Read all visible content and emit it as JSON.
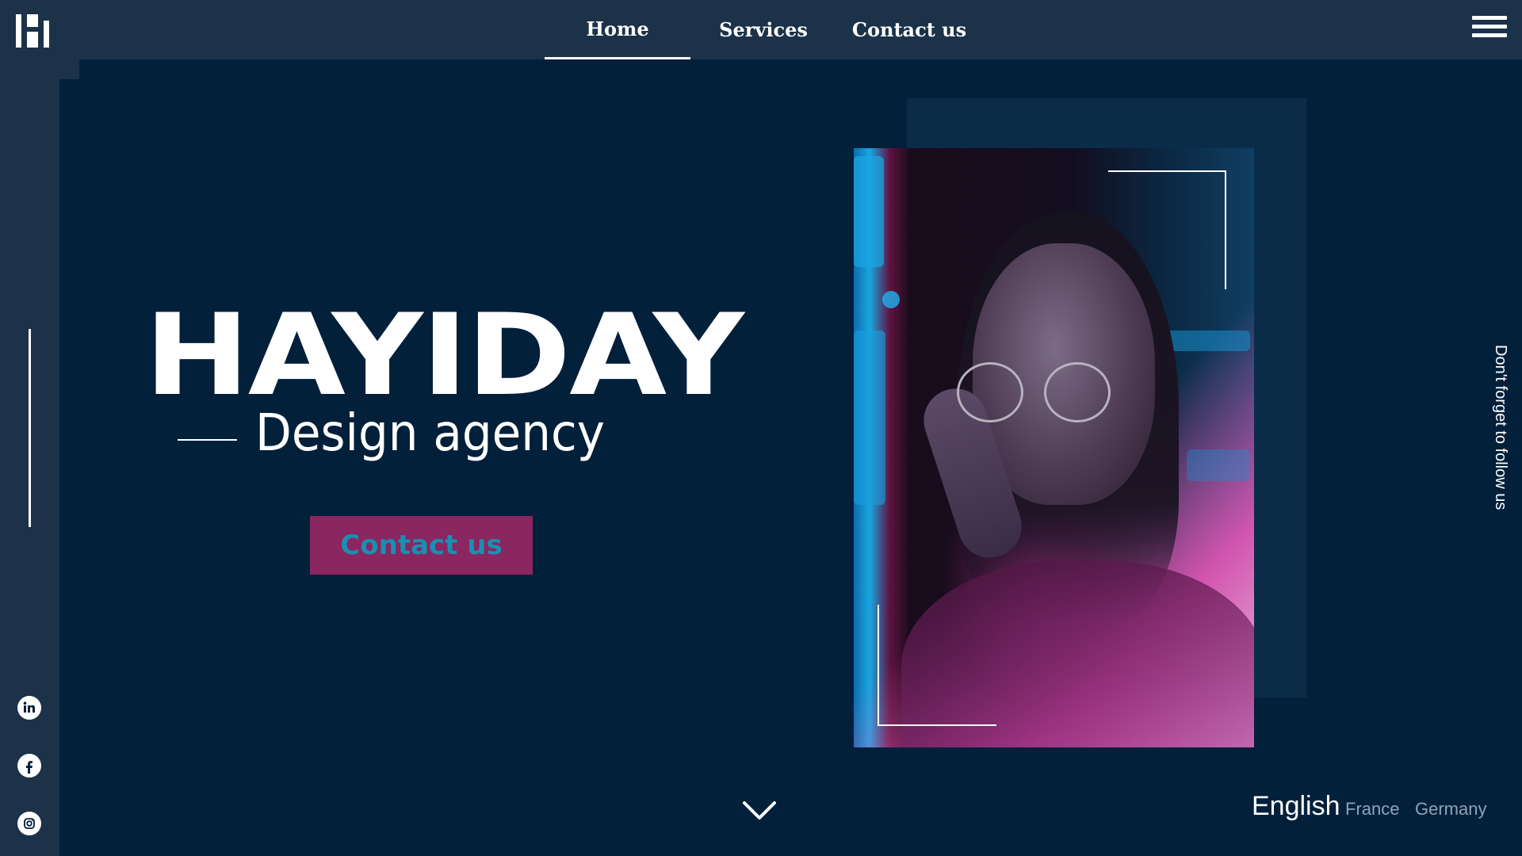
{
  "brand": {
    "logo_icon": "h-logo-icon"
  },
  "nav": {
    "items": [
      {
        "label": "Home",
        "active": true
      },
      {
        "label": "Services",
        "active": false
      },
      {
        "label": "Contact us",
        "active": false
      }
    ],
    "menu_icon": "hamburger-menu-icon"
  },
  "hero": {
    "title": "HAYIDAY",
    "subtitle": "Design agency",
    "cta_label": "Contact us"
  },
  "social": {
    "icons": [
      "linkedin-icon",
      "facebook-icon",
      "instagram-icon"
    ]
  },
  "follow_text": "Don't forget to follow us",
  "scroll_icon": "chevron-down-icon",
  "languages": [
    {
      "label": "English",
      "active": true
    },
    {
      "label": "France",
      "active": false
    },
    {
      "label": "Germany",
      "active": false
    }
  ],
  "colors": {
    "background": "#03203b",
    "panel": "#1b3249",
    "cta_background": "#8a2660",
    "cta_text": "#1a8fb2",
    "language_inactive": "#8fa3b6"
  }
}
